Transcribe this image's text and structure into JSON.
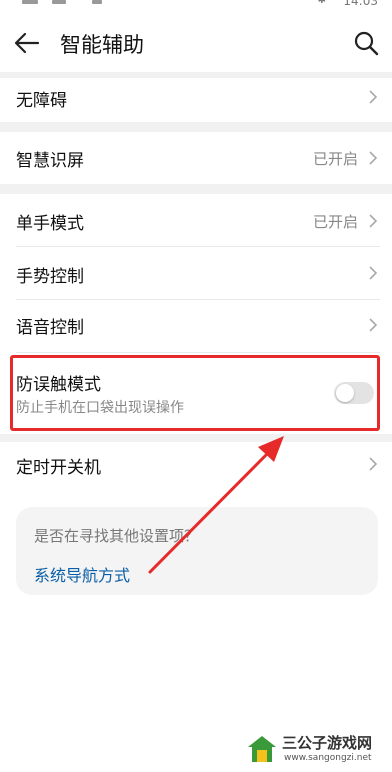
{
  "status_bar": {
    "time": "14:03"
  },
  "header": {
    "title": "智能辅助"
  },
  "items": [
    {
      "label": "无障碍",
      "value": ""
    },
    {
      "label": "智慧识屏",
      "value": "已开启"
    },
    {
      "label": "单手模式",
      "value": "已开启"
    },
    {
      "label": "手势控制",
      "value": ""
    },
    {
      "label": "语音控制",
      "value": ""
    }
  ],
  "mistouch": {
    "label": "防误触模式",
    "subtitle": "防止手机在口袋出现误操作",
    "enabled": false
  },
  "timer_item": {
    "label": "定时开关机"
  },
  "suggestion": {
    "question": "是否在寻找其他设置项？",
    "link": "系统导航方式"
  },
  "watermark": {
    "title": "三公子游戏网",
    "url": "www.sangongzi.net"
  },
  "colors": {
    "highlight": "#e62a2a",
    "link": "#0b5fa8",
    "toggle_off": "#e3e3e3"
  }
}
